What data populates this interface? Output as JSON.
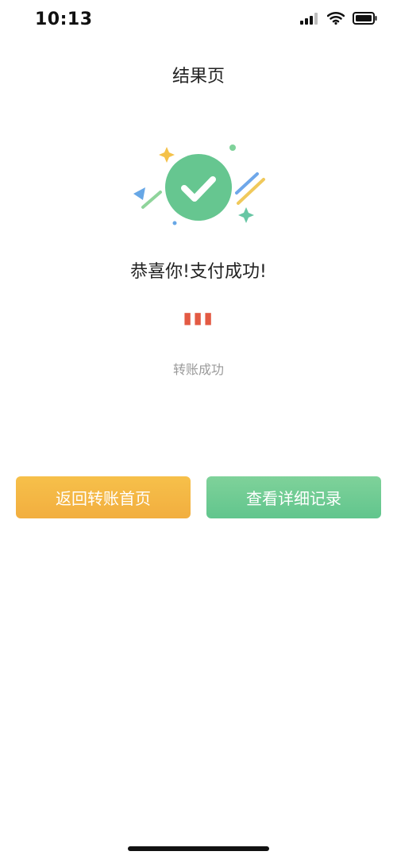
{
  "status_bar": {
    "time": "10:13"
  },
  "page": {
    "title": "结果页",
    "success_message": "恭喜你!支付成功!",
    "amount": "▮▮▮",
    "status_text": "转账成功"
  },
  "actions": {
    "back_label": "返回转账首页",
    "details_label": "查看详细记录"
  },
  "colors": {
    "accent_green": "#61c58d",
    "accent_orange": "#f2ae3f",
    "amount_red": "#e35a43"
  },
  "icons": {
    "success": "check-circle-icon",
    "signal": "signal-icon",
    "wifi": "wifi-icon",
    "battery": "battery-icon"
  }
}
